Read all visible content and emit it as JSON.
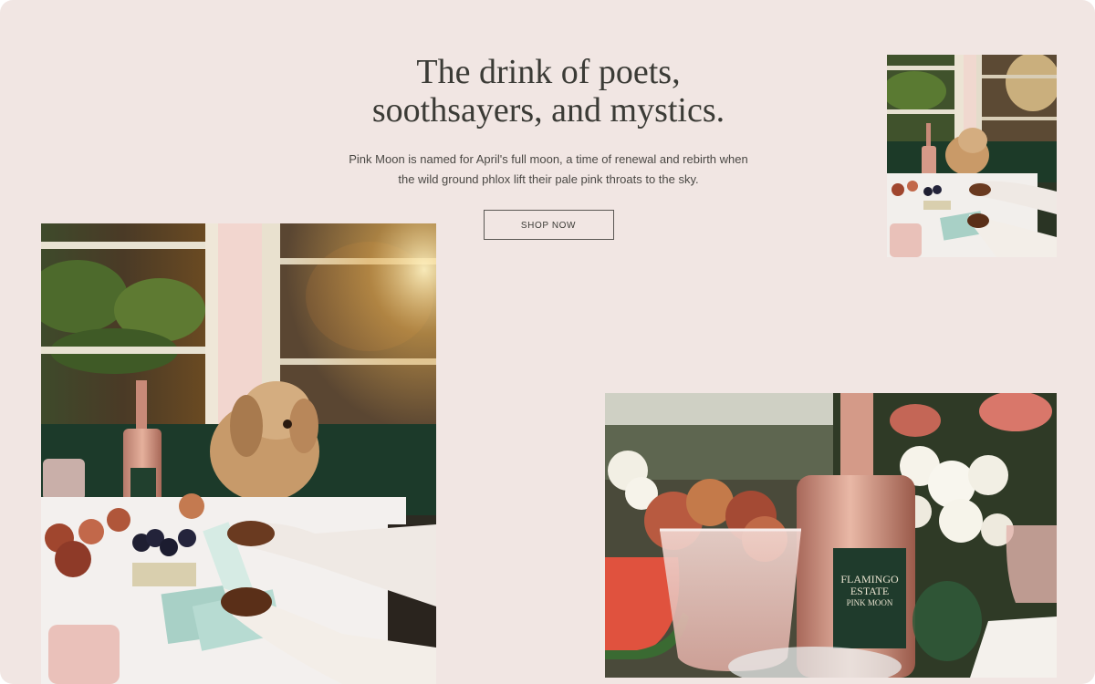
{
  "hero": {
    "headline_line1": "The drink of poets,",
    "headline_line2": "soothsayers, and mystics.",
    "body_line1": "Pink Moon is named for April's full moon, a time of renewal and rebirth when",
    "body_line2": "the wild ground phlox lift their pale pink throats to the sky.",
    "cta_label": "SHOP NOW"
  },
  "bottle_label": {
    "line1": "FLAMINGO",
    "line2": "ESTATE",
    "line3": "PINK MOON"
  },
  "colors": {
    "background": "#f1e6e3",
    "text": "#3b3b36",
    "bottle_label_green": "#1f3b2c"
  }
}
